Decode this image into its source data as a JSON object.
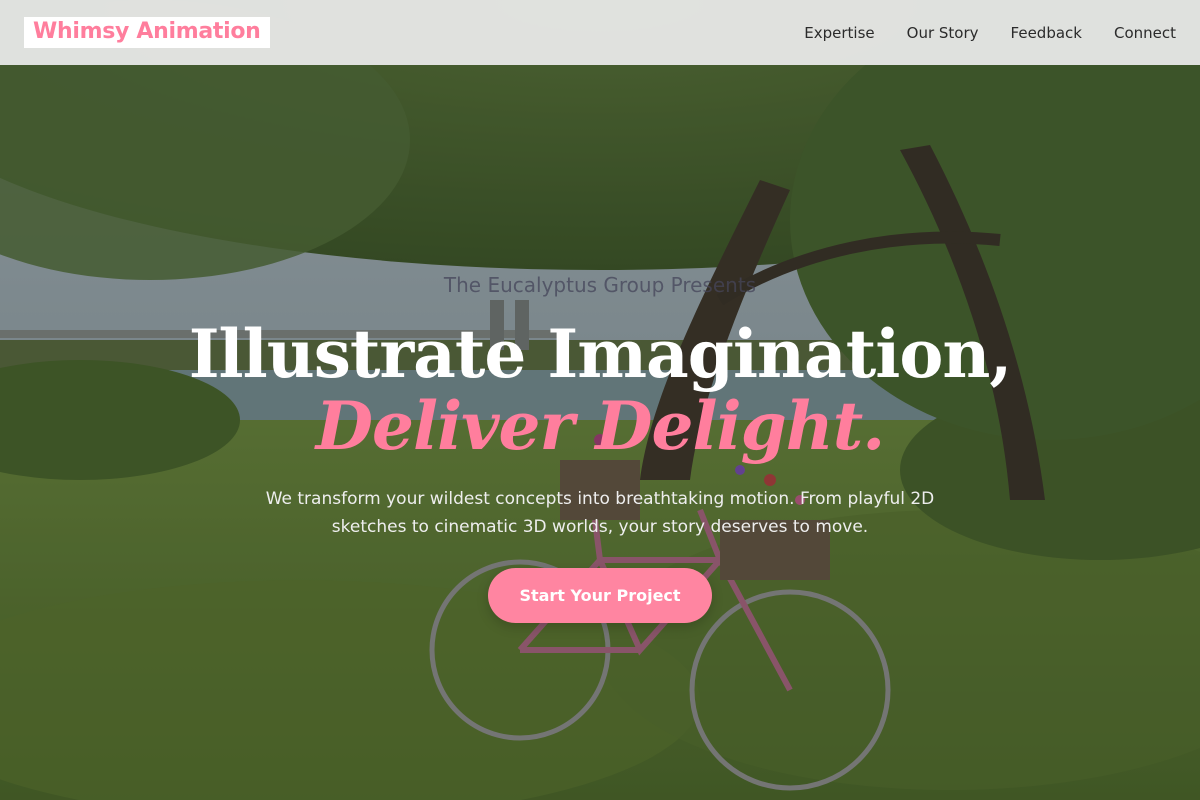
{
  "brand": {
    "name": "Whimsy Animation",
    "accent": "#ff7e9d"
  },
  "nav": {
    "items": [
      {
        "label": "Expertise"
      },
      {
        "label": "Our Story"
      },
      {
        "label": "Feedback"
      },
      {
        "label": "Connect"
      }
    ]
  },
  "hero": {
    "eyebrow": "The Eucalyptus Group Presents",
    "headline_line1": "Illustrate Imagination,",
    "headline_line2": "Deliver Delight.",
    "subtitle": "We transform your wildest concepts into breathtaking motion. From playful 2D sketches to cinematic 3D worlds, your story deserves to move.",
    "cta_label": "Start Your Project",
    "cta_color": "#ff85a1"
  },
  "background": {
    "subject": "bicycle-under-tree-by-lake-photo"
  }
}
